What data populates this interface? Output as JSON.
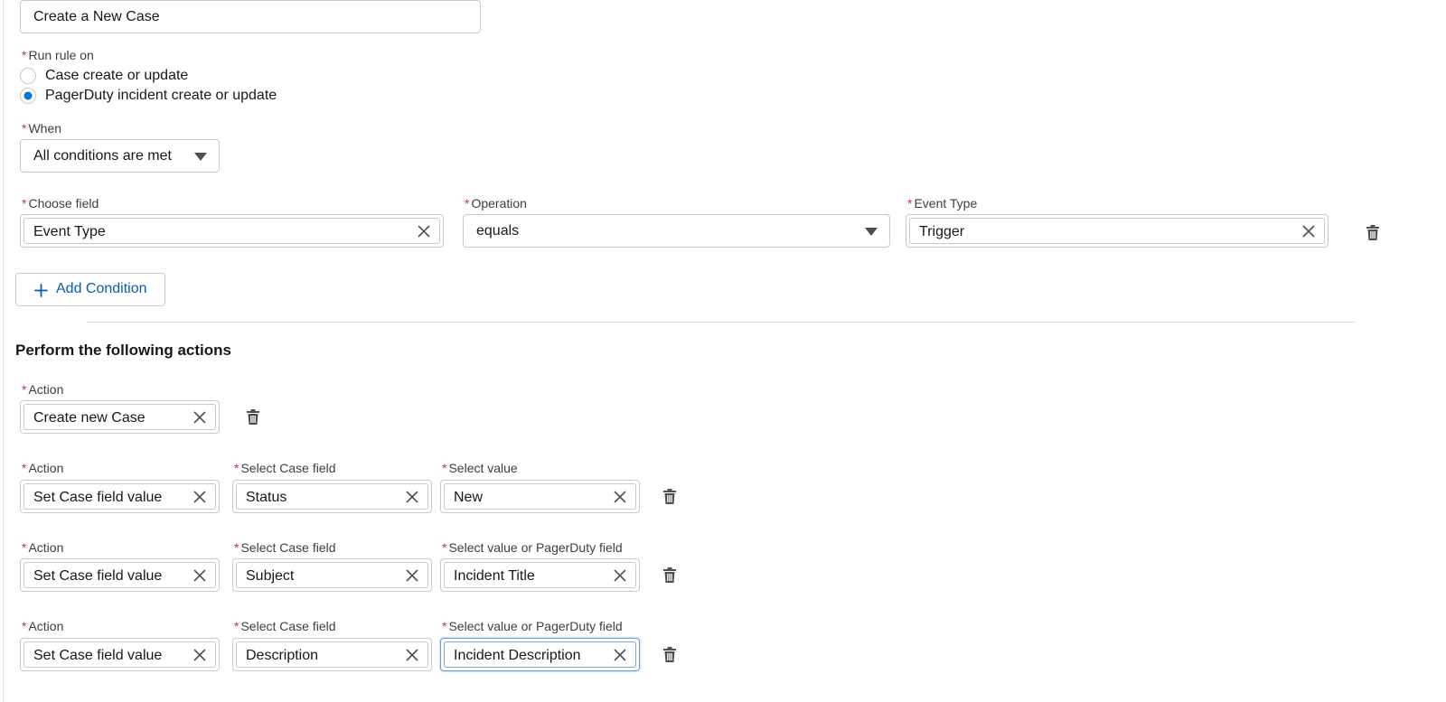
{
  "rule_name": {
    "value": "Create a New Case"
  },
  "run_rule_on": {
    "label": "Run rule on",
    "options": [
      {
        "label": "Case create or update",
        "selected": false
      },
      {
        "label": "PagerDuty incident create or update",
        "selected": true
      }
    ]
  },
  "when": {
    "label": "When",
    "value": "All conditions are met"
  },
  "condition": {
    "field_label": "Choose field",
    "field_value": "Event Type",
    "operation_label": "Operation",
    "operation_value": "equals",
    "value_label": "Event Type",
    "value_value": "Trigger"
  },
  "add_condition": {
    "label": "Add Condition"
  },
  "actions_section": {
    "title": "Perform the following actions"
  },
  "actions": [
    {
      "action_label": "Action",
      "action_value": "Create new Case"
    },
    {
      "action_label": "Action",
      "action_value": "Set Case field value",
      "field_label": "Select Case field",
      "field_value": "Status",
      "value_label": "Select value",
      "value_value": "New"
    },
    {
      "action_label": "Action",
      "action_value": "Set Case field value",
      "field_label": "Select Case field",
      "field_value": "Subject",
      "value_label": "Select value or PagerDuty field",
      "value_value": "Incident Title"
    },
    {
      "action_label": "Action",
      "action_value": "Set Case field value",
      "field_label": "Select Case field",
      "field_value": "Description",
      "value_label": "Select value or PagerDuty field",
      "value_value": "Incident Description",
      "value_focused": true
    }
  ],
  "colors": {
    "brand": "#0176d3",
    "link": "#0b5cab",
    "required": "#c23934",
    "border": "#c9c9c9"
  },
  "icons": {
    "remove": "close-icon",
    "delete": "trash-icon",
    "dropdown": "caret-down-icon",
    "add": "plus-icon"
  }
}
